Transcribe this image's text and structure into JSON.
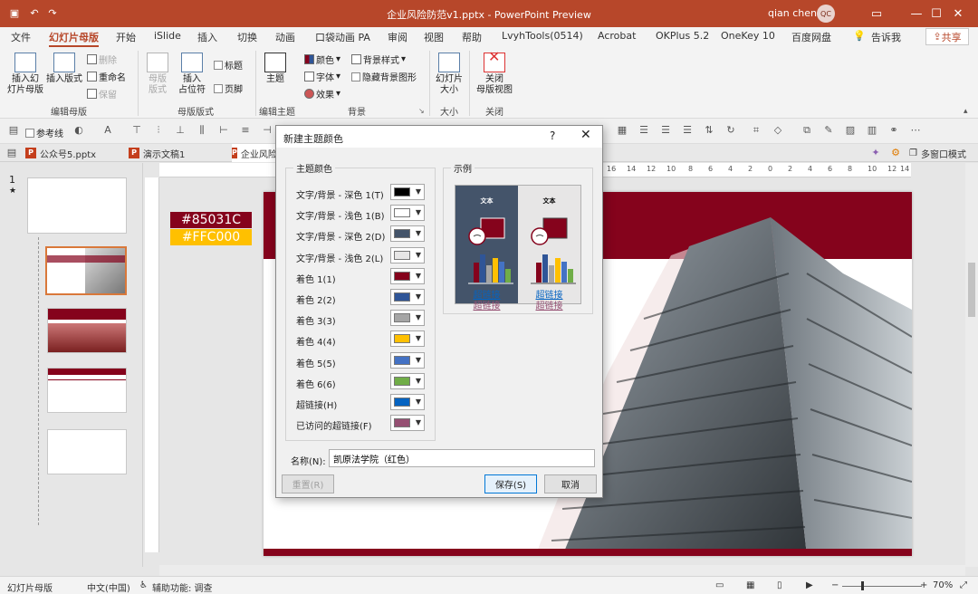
{
  "window": {
    "title": "企业风险防范v1.pptx  -  PowerPoint Preview",
    "user_name": "qian chen",
    "user_initials": "QC"
  },
  "menu_tabs": [
    "文件",
    "幻灯片母版",
    "开始",
    "iSlide",
    "插入",
    "切换",
    "动画",
    "口袋动画 PA",
    "审阅",
    "视图",
    "帮助",
    "LvyhTools(0514)",
    "Acrobat",
    "OKPlus 5.2",
    "OneKey 10",
    "百度网盘"
  ],
  "tell_me": "告诉我",
  "share_label": "共享",
  "ribbon": {
    "insert_slide_master": [
      "插入幻",
      "灯片母版"
    ],
    "insert_layout": "插入版式",
    "delete": "删除",
    "rename": "重命名",
    "preserve": "保留",
    "master_layout": [
      "母版",
      "版式"
    ],
    "insert_placeholder": [
      "插入",
      "占位符"
    ],
    "title_check": "标题",
    "footer_check": "页脚",
    "theme": "主题",
    "colors": "颜色",
    "fonts": "字体",
    "effects": "效果",
    "background_styles": "背景样式",
    "hide_bg_graphics": "隐藏背景图形",
    "slide_size": [
      "幻灯片",
      "大小"
    ],
    "close_master": [
      "关闭",
      "母版视图"
    ],
    "groups": {
      "edit_master": "编辑母版",
      "master_layout": "母版版式",
      "edit_theme": "编辑主题",
      "background": "背景",
      "size": "大小",
      "close": "关闭"
    }
  },
  "toolbar2": {
    "guides": "参考线",
    "multi_window": "多窗口模式"
  },
  "doc_tabs": [
    "公众号5.pptx",
    "演示文稿1",
    "企业风险防范v1.pptx"
  ],
  "slide_panel": {
    "number": "1",
    "star": "★"
  },
  "ruler_labels": [
    "16",
    "14",
    "12",
    "10",
    "8",
    "6",
    "4",
    "2",
    "0",
    "2",
    "4",
    "6",
    "8",
    "10",
    "12",
    "14",
    "16"
  ],
  "slide": {
    "tag1": "#85031C",
    "tag2": "#FFC000"
  },
  "status": {
    "view": "幻灯片母版",
    "language": "中文(中国)",
    "accessibility": "辅助功能: 调查",
    "zoom": "70%"
  },
  "dialog": {
    "title": "新建主题颜色",
    "help": "?",
    "theme_colors_legend": "主题颜色",
    "sample_legend": "示例",
    "rows": [
      {
        "label": "文字/背景 - 深色 1(T)",
        "color": "#000000"
      },
      {
        "label": "文字/背景 - 浅色 1(B)",
        "color": "#FFFFFF"
      },
      {
        "label": "文字/背景 - 深色 2(D)",
        "color": "#44546A"
      },
      {
        "label": "文字/背景 - 浅色 2(L)",
        "color": "#E7E6E6"
      },
      {
        "label": "着色 1(1)",
        "color": "#85031C"
      },
      {
        "label": "着色 2(2)",
        "color": "#2F5597"
      },
      {
        "label": "着色 3(3)",
        "color": "#A5A5A5"
      },
      {
        "label": "着色 4(4)",
        "color": "#FFC000"
      },
      {
        "label": "着色 5(5)",
        "color": "#4472C4"
      },
      {
        "label": "着色 6(6)",
        "color": "#70AD47"
      },
      {
        "label": "超链接(H)",
        "color": "#0563C1"
      },
      {
        "label": "已访问的超链接(F)",
        "color": "#954F72"
      }
    ],
    "sample": {
      "text_label": "文本",
      "hyperlink": "超链接",
      "visited": "超链接"
    },
    "name_label": "名称(N):",
    "name_value": "凯原法学院（红色）",
    "reset": "重置(R)",
    "save": "保存(S)",
    "cancel": "取消"
  },
  "colors": {
    "accent": "#b7472a",
    "brand_red": "#85031C",
    "gold": "#FFC000"
  }
}
